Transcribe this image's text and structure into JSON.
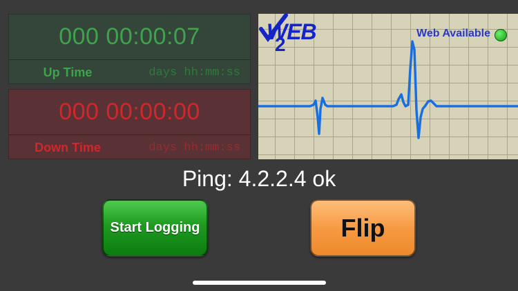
{
  "uptime": {
    "value": "000 00:00:07",
    "label": "Up Time",
    "format": "days hh:mm:ss"
  },
  "downtime": {
    "value": "000 00:00:00",
    "label": "Down Time",
    "format": "days hh:mm:ss"
  },
  "graph": {
    "logo_text": "WEB",
    "logo_sub": "2",
    "status_text": "Web Available",
    "status_color": "#2cc52c"
  },
  "ping": {
    "text": "Ping: 4.2.2.4 ok"
  },
  "buttons": {
    "start_label": "Start Logging",
    "flip_label": "Flip"
  },
  "colors": {
    "up": "#3fa24d",
    "down": "#d0272b",
    "trace": "#1a6fe0"
  }
}
